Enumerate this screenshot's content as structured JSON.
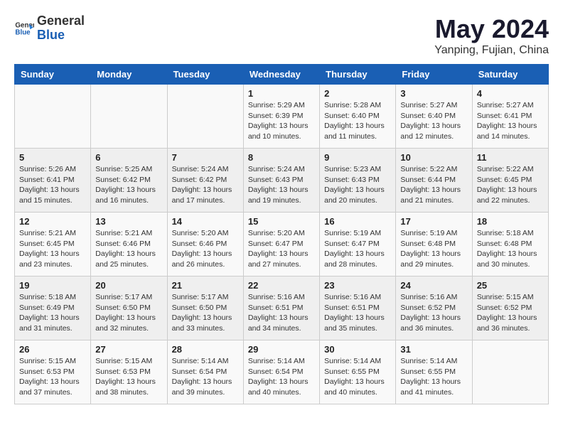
{
  "logo": {
    "general": "General",
    "blue": "Blue"
  },
  "title": "May 2024",
  "subtitle": "Yanping, Fujian, China",
  "days_of_week": [
    "Sunday",
    "Monday",
    "Tuesday",
    "Wednesday",
    "Thursday",
    "Friday",
    "Saturday"
  ],
  "weeks": [
    [
      {
        "day": "",
        "info": ""
      },
      {
        "day": "",
        "info": ""
      },
      {
        "day": "",
        "info": ""
      },
      {
        "day": "1",
        "info": "Sunrise: 5:29 AM\nSunset: 6:39 PM\nDaylight: 13 hours\nand 10 minutes."
      },
      {
        "day": "2",
        "info": "Sunrise: 5:28 AM\nSunset: 6:40 PM\nDaylight: 13 hours\nand 11 minutes."
      },
      {
        "day": "3",
        "info": "Sunrise: 5:27 AM\nSunset: 6:40 PM\nDaylight: 13 hours\nand 12 minutes."
      },
      {
        "day": "4",
        "info": "Sunrise: 5:27 AM\nSunset: 6:41 PM\nDaylight: 13 hours\nand 14 minutes."
      }
    ],
    [
      {
        "day": "5",
        "info": "Sunrise: 5:26 AM\nSunset: 6:41 PM\nDaylight: 13 hours\nand 15 minutes."
      },
      {
        "day": "6",
        "info": "Sunrise: 5:25 AM\nSunset: 6:42 PM\nDaylight: 13 hours\nand 16 minutes."
      },
      {
        "day": "7",
        "info": "Sunrise: 5:24 AM\nSunset: 6:42 PM\nDaylight: 13 hours\nand 17 minutes."
      },
      {
        "day": "8",
        "info": "Sunrise: 5:24 AM\nSunset: 6:43 PM\nDaylight: 13 hours\nand 19 minutes."
      },
      {
        "day": "9",
        "info": "Sunrise: 5:23 AM\nSunset: 6:43 PM\nDaylight: 13 hours\nand 20 minutes."
      },
      {
        "day": "10",
        "info": "Sunrise: 5:22 AM\nSunset: 6:44 PM\nDaylight: 13 hours\nand 21 minutes."
      },
      {
        "day": "11",
        "info": "Sunrise: 5:22 AM\nSunset: 6:45 PM\nDaylight: 13 hours\nand 22 minutes."
      }
    ],
    [
      {
        "day": "12",
        "info": "Sunrise: 5:21 AM\nSunset: 6:45 PM\nDaylight: 13 hours\nand 23 minutes."
      },
      {
        "day": "13",
        "info": "Sunrise: 5:21 AM\nSunset: 6:46 PM\nDaylight: 13 hours\nand 25 minutes."
      },
      {
        "day": "14",
        "info": "Sunrise: 5:20 AM\nSunset: 6:46 PM\nDaylight: 13 hours\nand 26 minutes."
      },
      {
        "day": "15",
        "info": "Sunrise: 5:20 AM\nSunset: 6:47 PM\nDaylight: 13 hours\nand 27 minutes."
      },
      {
        "day": "16",
        "info": "Sunrise: 5:19 AM\nSunset: 6:47 PM\nDaylight: 13 hours\nand 28 minutes."
      },
      {
        "day": "17",
        "info": "Sunrise: 5:19 AM\nSunset: 6:48 PM\nDaylight: 13 hours\nand 29 minutes."
      },
      {
        "day": "18",
        "info": "Sunrise: 5:18 AM\nSunset: 6:48 PM\nDaylight: 13 hours\nand 30 minutes."
      }
    ],
    [
      {
        "day": "19",
        "info": "Sunrise: 5:18 AM\nSunset: 6:49 PM\nDaylight: 13 hours\nand 31 minutes."
      },
      {
        "day": "20",
        "info": "Sunrise: 5:17 AM\nSunset: 6:50 PM\nDaylight: 13 hours\nand 32 minutes."
      },
      {
        "day": "21",
        "info": "Sunrise: 5:17 AM\nSunset: 6:50 PM\nDaylight: 13 hours\nand 33 minutes."
      },
      {
        "day": "22",
        "info": "Sunrise: 5:16 AM\nSunset: 6:51 PM\nDaylight: 13 hours\nand 34 minutes."
      },
      {
        "day": "23",
        "info": "Sunrise: 5:16 AM\nSunset: 6:51 PM\nDaylight: 13 hours\nand 35 minutes."
      },
      {
        "day": "24",
        "info": "Sunrise: 5:16 AM\nSunset: 6:52 PM\nDaylight: 13 hours\nand 36 minutes."
      },
      {
        "day": "25",
        "info": "Sunrise: 5:15 AM\nSunset: 6:52 PM\nDaylight: 13 hours\nand 36 minutes."
      }
    ],
    [
      {
        "day": "26",
        "info": "Sunrise: 5:15 AM\nSunset: 6:53 PM\nDaylight: 13 hours\nand 37 minutes."
      },
      {
        "day": "27",
        "info": "Sunrise: 5:15 AM\nSunset: 6:53 PM\nDaylight: 13 hours\nand 38 minutes."
      },
      {
        "day": "28",
        "info": "Sunrise: 5:14 AM\nSunset: 6:54 PM\nDaylight: 13 hours\nand 39 minutes."
      },
      {
        "day": "29",
        "info": "Sunrise: 5:14 AM\nSunset: 6:54 PM\nDaylight: 13 hours\nand 40 minutes."
      },
      {
        "day": "30",
        "info": "Sunrise: 5:14 AM\nSunset: 6:55 PM\nDaylight: 13 hours\nand 40 minutes."
      },
      {
        "day": "31",
        "info": "Sunrise: 5:14 AM\nSunset: 6:55 PM\nDaylight: 13 hours\nand 41 minutes."
      },
      {
        "day": "",
        "info": ""
      }
    ]
  ]
}
